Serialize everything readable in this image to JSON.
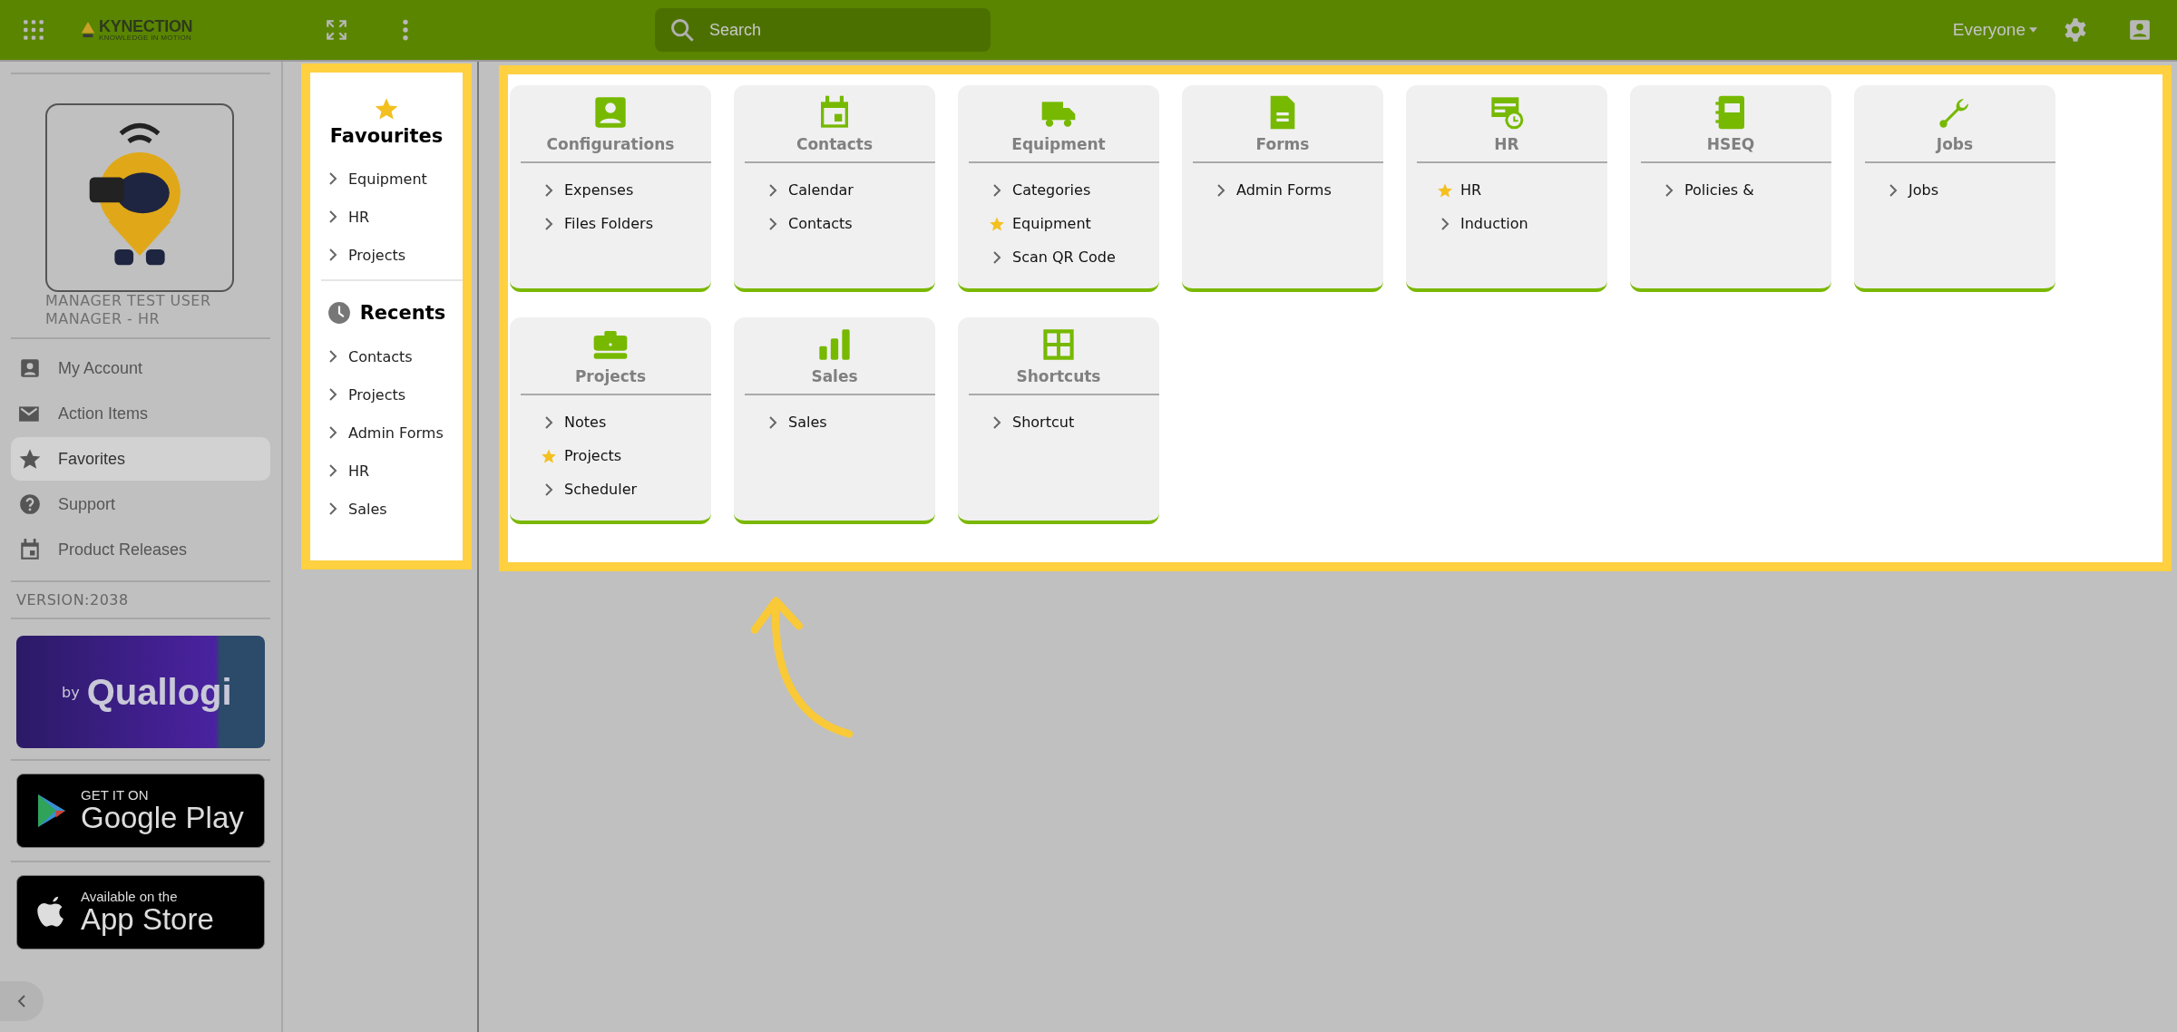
{
  "topbar": {
    "logo_name": "KYNECTION",
    "logo_tagline": "KNOWLEDGE IN MOTION",
    "search": {
      "placeholder": "Search"
    },
    "audience": "Everyone"
  },
  "user": {
    "name": "MANAGER TEST USER",
    "role": "MANAGER - HR"
  },
  "sidebar": {
    "items": [
      {
        "label": "My Account",
        "selected": false
      },
      {
        "label": "Action Items",
        "selected": false
      },
      {
        "label": "Favorites",
        "selected": true
      },
      {
        "label": "Support",
        "selected": false
      },
      {
        "label": "Product Releases",
        "selected": false
      }
    ],
    "version": "VERSION:2038",
    "banner": {
      "by": "by",
      "brand": "Quallogi"
    },
    "google_play": {
      "line1": "GET IT ON",
      "line2": "Google Play"
    },
    "app_store": {
      "line1": "Available on the",
      "line2": "App Store"
    }
  },
  "favourites": {
    "title": "Favourites",
    "items": [
      "Equipment",
      "HR",
      "Projects"
    ]
  },
  "recents": {
    "title": "Recents",
    "items": [
      "Contacts",
      "Projects",
      "Admin Forms",
      "HR",
      "Sales"
    ]
  },
  "cards": [
    {
      "title": "Configurations",
      "links": [
        {
          "label": "Expenses",
          "starred": false
        },
        {
          "label": "Files Folders",
          "starred": false
        }
      ]
    },
    {
      "title": "Contacts",
      "links": [
        {
          "label": "Calendar",
          "starred": false
        },
        {
          "label": "Contacts",
          "starred": false
        }
      ]
    },
    {
      "title": "Equipment",
      "links": [
        {
          "label": "Categories",
          "starred": false
        },
        {
          "label": "Equipment",
          "starred": true
        },
        {
          "label": "Scan QR Code",
          "starred": false
        }
      ]
    },
    {
      "title": "Forms",
      "links": [
        {
          "label": "Admin Forms",
          "starred": false
        }
      ]
    },
    {
      "title": "HR",
      "links": [
        {
          "label": "HR",
          "starred": true
        },
        {
          "label": "Induction",
          "starred": false
        }
      ]
    },
    {
      "title": "HSEQ",
      "links": [
        {
          "label": "Policies &",
          "starred": false
        }
      ]
    },
    {
      "title": "Jobs",
      "links": [
        {
          "label": "Jobs",
          "starred": false
        }
      ]
    },
    {
      "title": "Projects",
      "links": [
        {
          "label": "Notes",
          "starred": false
        },
        {
          "label": "Projects",
          "starred": true
        },
        {
          "label": "Scheduler",
          "starred": false
        }
      ]
    },
    {
      "title": "Sales",
      "links": [
        {
          "label": "Sales",
          "starred": false
        }
      ]
    },
    {
      "title": "Shortcuts",
      "links": [
        {
          "label": "Shortcut",
          "starred": false
        }
      ]
    }
  ]
}
